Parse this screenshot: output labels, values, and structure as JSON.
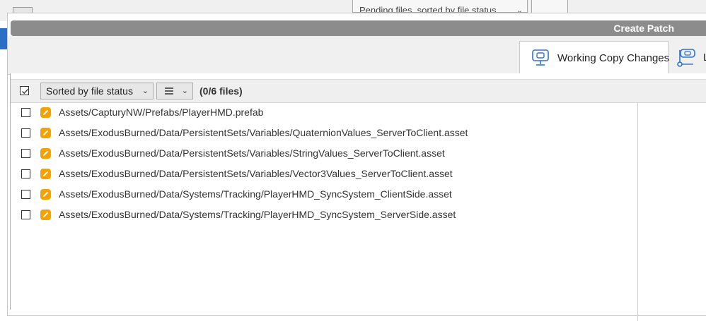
{
  "background": {
    "dropdown_label": "Pending files, sorted by file status"
  },
  "dialog": {
    "title": "Create Patch",
    "tabs": [
      {
        "label": "Working Copy Changes",
        "active": true
      },
      {
        "label": "L",
        "active": false
      }
    ]
  },
  "toolbar": {
    "sort_label": "Sorted by file status",
    "file_count": "(0/6 files)"
  },
  "files": [
    {
      "path": "Assets/CapturyNW/Prefabs/PlayerHMD.prefab",
      "checked": false,
      "status": "modified"
    },
    {
      "path": "Assets/ExodusBurned/Data/PersistentSets/Variables/QuaternionValues_ServerToClient.asset",
      "checked": false,
      "status": "modified"
    },
    {
      "path": "Assets/ExodusBurned/Data/PersistentSets/Variables/StringValues_ServerToClient.asset",
      "checked": false,
      "status": "modified"
    },
    {
      "path": "Assets/ExodusBurned/Data/PersistentSets/Variables/Vector3Values_ServerToClient.asset",
      "checked": false,
      "status": "modified"
    },
    {
      "path": "Assets/ExodusBurned/Data/Systems/Tracking/PlayerHMD_SyncSystem_ClientSide.asset",
      "checked": false,
      "status": "modified"
    },
    {
      "path": "Assets/ExodusBurned/Data/Systems/Tracking/PlayerHMD_SyncSystem_ServerSide.asset",
      "checked": false,
      "status": "modified"
    }
  ],
  "colors": {
    "title_bar": "#8c8c8c",
    "modified_badge": "#f5a100"
  },
  "icons": {
    "modified": "pencil-icon",
    "working_copy_tab": "monitor-icon",
    "log_tab": "branch-icon",
    "view_mode": "list-icon"
  }
}
